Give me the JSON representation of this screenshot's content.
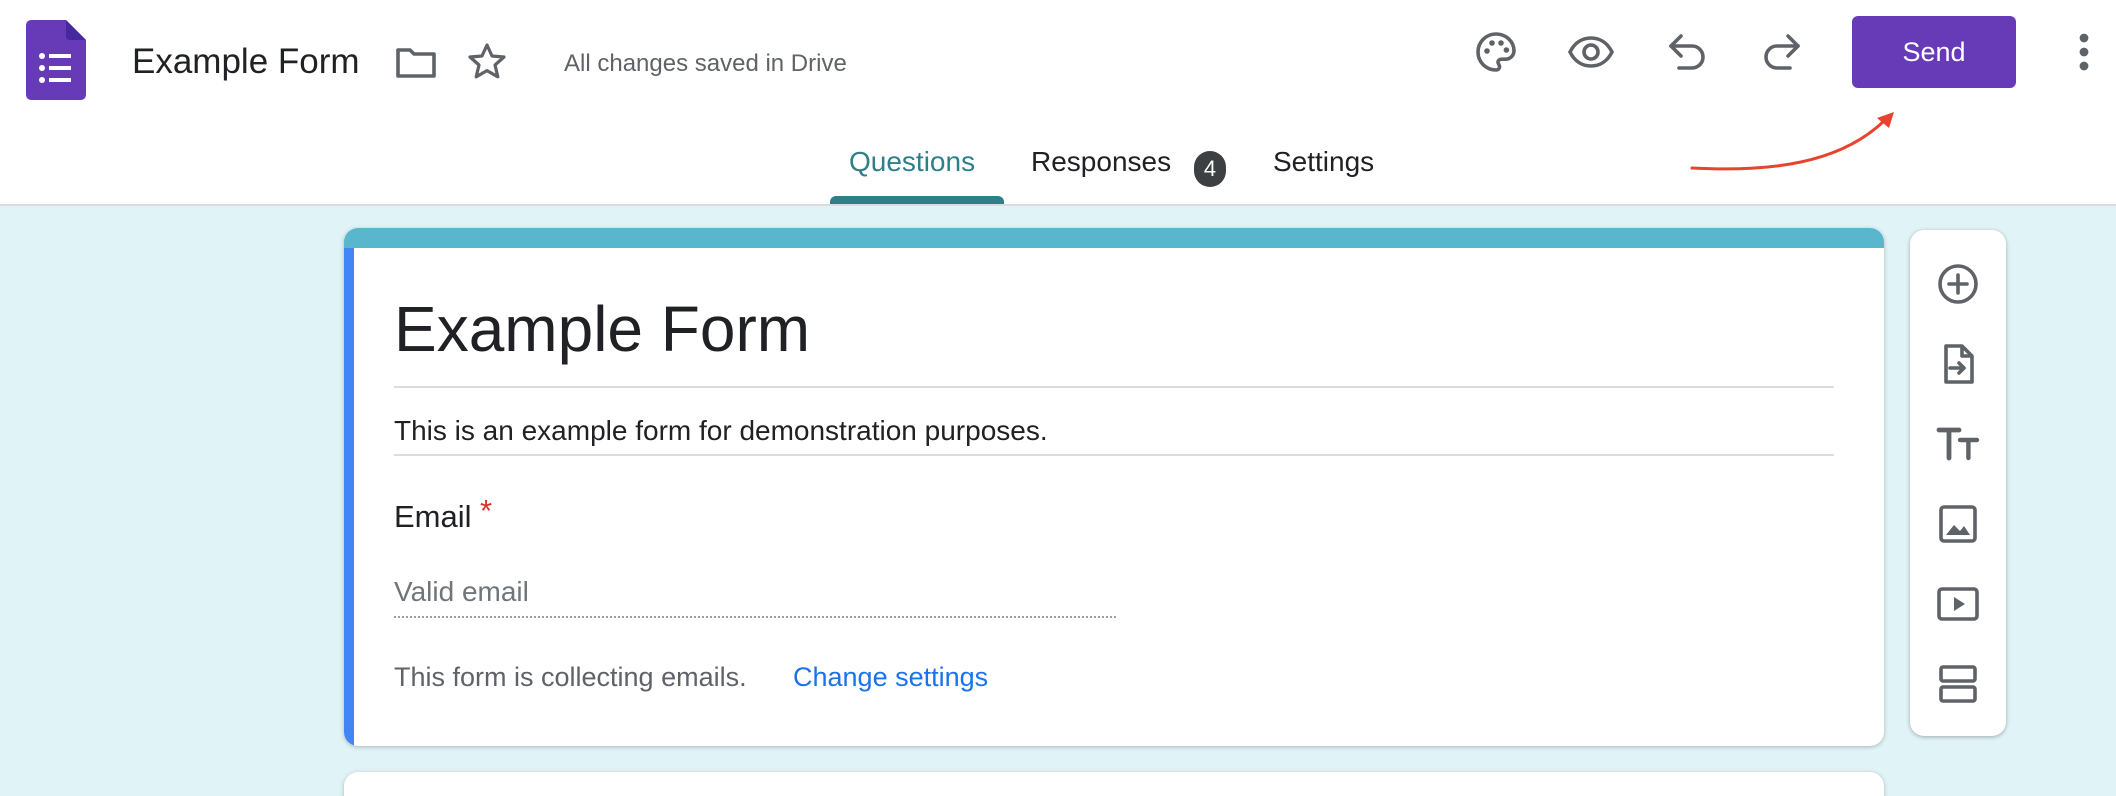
{
  "header": {
    "doc_title": "Example Form",
    "save_status": "All changes saved in Drive",
    "send_label": "Send",
    "icons": [
      "forms-logo-icon",
      "folder-icon",
      "star-icon",
      "palette-icon",
      "eye-icon",
      "undo-icon",
      "redo-icon",
      "more-vert-icon"
    ]
  },
  "tabs": [
    {
      "label": "Questions",
      "active": true
    },
    {
      "label": "Responses",
      "badge": "4"
    },
    {
      "label": "Settings"
    }
  ],
  "form": {
    "title": "Example Form",
    "description": "This is an example form for demonstration purposes.",
    "email_label": "Email",
    "required_mark": "*",
    "email_placeholder": "Valid email",
    "collect_note": "This form is collecting emails.",
    "change_settings": "Change settings"
  },
  "side_toolbar": [
    "add-question-icon",
    "import-questions-icon",
    "add-title-icon",
    "add-image-icon",
    "add-video-icon",
    "add-section-icon"
  ],
  "colors": {
    "accent": "#673ab7",
    "tab_active": "#2f7f89",
    "header_band": "#58b7cc",
    "left_band": "#4285f4",
    "canvas_bg": "#e0f3f6",
    "link": "#1a73e8",
    "required": "#d93025",
    "annotation_arrow": "#e8432f"
  }
}
